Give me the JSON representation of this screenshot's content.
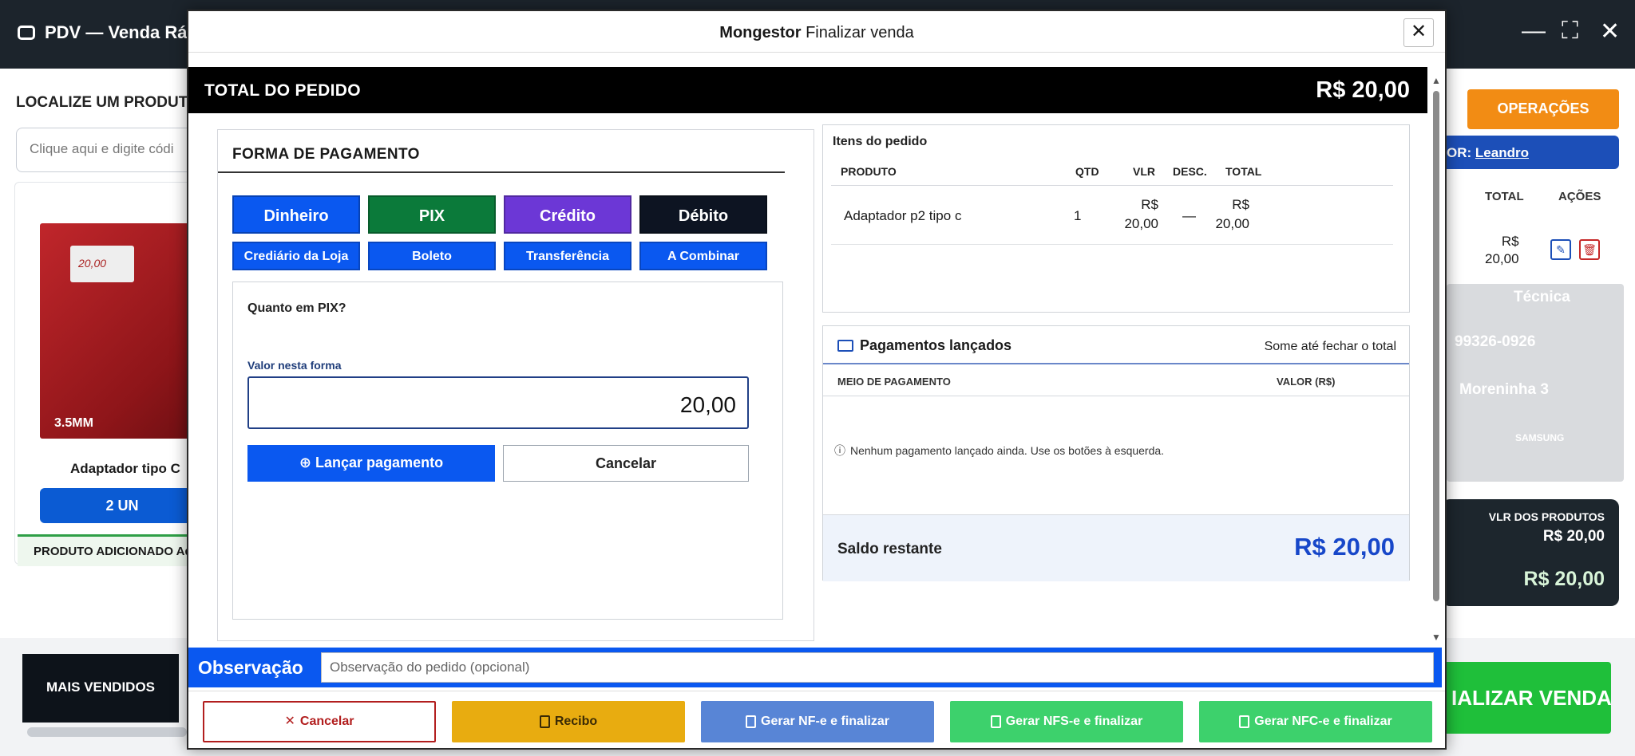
{
  "background": {
    "app_title": "PDV — Venda Ráp",
    "window_controls": {
      "minimize": "—",
      "maximize": "⛶",
      "close": "✕"
    },
    "locate_label": "LOCALIZE UM PRODUTO",
    "search_placeholder": "Clique aqui e digite códi",
    "product": {
      "image_tag": "20,00",
      "image_label": "3.5MM",
      "name": "Adaptador tipo C",
      "qty_button": "2 UN",
      "added_text": "PRODUTO ADICIONADO Ad"
    },
    "operations_button": "OPERAÇÕES",
    "vendor_prefix": "OR:",
    "vendor_name": "Leandro",
    "cart_columns": {
      "total": "TOTAL",
      "actions": "AÇÕES"
    },
    "cart_row": {
      "total_line1": "R$",
      "total_line2": "20,00"
    },
    "tech_card": {
      "title": "Técnica",
      "phone": "99326-0926",
      "address": "Moreninha 3",
      "brand": "SAMSUNG"
    },
    "totals_card": {
      "products_label": "VLR DOS PRODUTOS",
      "products_value": "R$ 20,00",
      "grand_total": "R$ 20,00"
    },
    "best_sellers_button": "MAIS VENDIDOS",
    "finalize_button": "IALIZAR VENDA"
  },
  "modal": {
    "title_app": "Mongestor",
    "title_text": "Finalizar venda",
    "close": "✕",
    "total_label": "TOTAL DO PEDIDO",
    "total_value": "R$ 20,00",
    "payment": {
      "title": "FORMA DE PAGAMENTO",
      "main_methods": [
        {
          "label": "Dinheiro",
          "color": "#0a58f0"
        },
        {
          "label": "PIX",
          "color": "#0b7a3a"
        },
        {
          "label": "Crédito",
          "color": "#6c37d6"
        },
        {
          "label": "Débito",
          "color": "#0d1422"
        }
      ],
      "secondary_methods": [
        "Crediário da Loja",
        "Boleto",
        "Transferência",
        "A Combinar"
      ],
      "question": "Quanto em PIX?",
      "value_label": "Valor nesta forma",
      "value": "20,00",
      "launch_button": "Lançar pagamento",
      "cancel_button": "Cancelar"
    },
    "items": {
      "title": "Itens do pedido",
      "columns": {
        "product": "PRODUTO",
        "qty": "QTD",
        "unit": "VLR",
        "disc": "DESC.",
        "total": "TOTAL"
      },
      "rows": [
        {
          "product": "Adaptador p2 tipo c",
          "qty": "1",
          "unit_line1": "R$",
          "unit_line2": "20,00",
          "disc": "—",
          "total_line1": "R$",
          "total_line2": "20,00"
        }
      ]
    },
    "launched": {
      "title": "Pagamentos lançados",
      "hint": "Some até fechar o total",
      "col_method": "MEIO DE PAGAMENTO",
      "col_value": "VALOR (R$)",
      "empty": "Nenhum pagamento lançado ainda. Use os botões à esquerda.",
      "balance_label": "Saldo restante",
      "balance_value": "R$ 20,00"
    },
    "observation": {
      "label": "Observação",
      "placeholder": "Observação do pedido (opcional)"
    },
    "footer": {
      "cancel": "Cancelar",
      "receipt": "Recibo",
      "nfe": "Gerar NF-e e finalizar",
      "nfse": "Gerar NFS-e e finalizar",
      "nfce": "Gerar NFC-e e finalizar"
    }
  },
  "colors": {
    "accent_blue": "#0a58f0",
    "balance_blue": "#1747c9",
    "header_black": "#000000",
    "receipt_yellow": "#e8ac10",
    "green": "#3dd16c"
  }
}
